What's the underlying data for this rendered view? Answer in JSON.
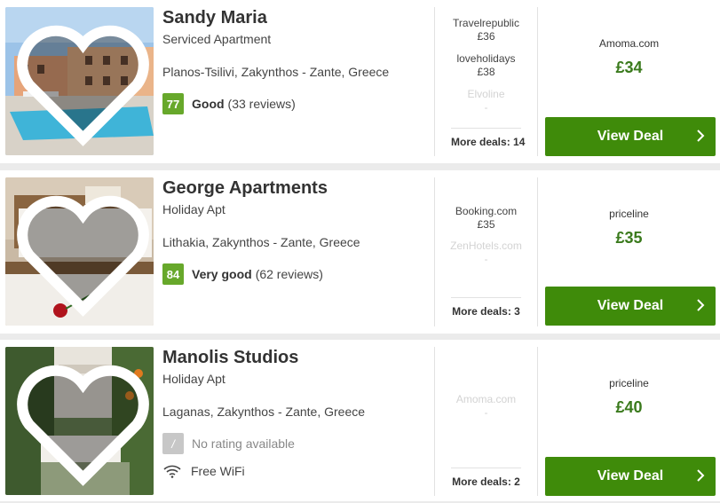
{
  "hotels": [
    {
      "name": "Sandy Maria",
      "type": "Serviced Apartment",
      "location": "Planos-Tsilivi, Zakynthos - Zante, Greece",
      "rating": {
        "score": "77",
        "label": "Good",
        "count": "(33 reviews)"
      },
      "other_deals": [
        {
          "provider": "Travelrepublic",
          "price": "£36"
        },
        {
          "provider": "loveholidays",
          "price": "£38"
        },
        {
          "provider": "Elvoline",
          "price": "-"
        }
      ],
      "more_deals": "More deals: 14",
      "best_provider": "Amoma.com",
      "best_price": "£34",
      "button_label": "View Deal"
    },
    {
      "name": "George Apartments",
      "type": "Holiday Apt",
      "location": "Lithakia, Zakynthos - Zante, Greece",
      "rating": {
        "score": "84",
        "label": "Very good",
        "count": "(62 reviews)"
      },
      "other_deals": [
        {
          "provider": "Booking.com",
          "price": "£35"
        },
        {
          "provider": "ZenHotels.com",
          "price": "-"
        }
      ],
      "more_deals": "More deals: 3",
      "best_provider": "priceline",
      "best_price": "£35",
      "button_label": "View Deal"
    },
    {
      "name": "Manolis Studios",
      "type": "Holiday Apt",
      "location": "Laganas, Zakynthos - Zante, Greece",
      "rating": {
        "score": "/",
        "label": "",
        "count": "No rating available"
      },
      "amenity": "Free WiFi",
      "other_deals": [
        {
          "provider": "Amoma.com",
          "price": "-"
        }
      ],
      "more_deals": "More deals: 2",
      "best_provider": "priceline",
      "best_price": "£40",
      "button_label": "View Deal"
    }
  ],
  "colors": {
    "deal_button": "#3f8b0a",
    "price": "#3a7a1c",
    "rating_badge": "#67a82b"
  }
}
